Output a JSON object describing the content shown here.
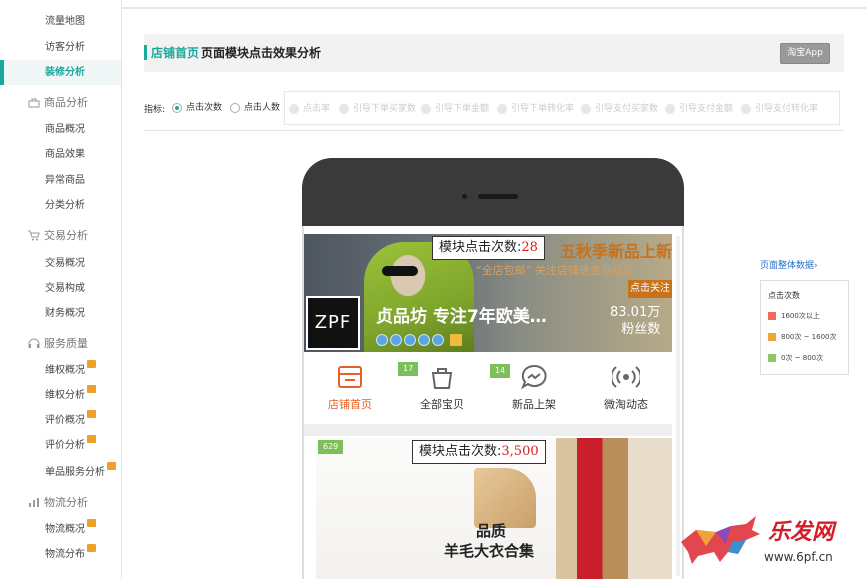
{
  "sidebar": {
    "items_top": [
      {
        "label": "流量地图"
      },
      {
        "label": "访客分析"
      },
      {
        "label": "装修分析",
        "active": true
      }
    ],
    "groups": [
      {
        "title": "商品分析",
        "icon": "bag-icon",
        "items": [
          "商品概况",
          "商品效果",
          "异常商品",
          "分类分析"
        ]
      },
      {
        "title": "交易分析",
        "icon": "cart-icon",
        "items": [
          "交易概况",
          "交易构成",
          "财务概况"
        ]
      },
      {
        "title": "服务质量",
        "icon": "headset-icon",
        "items": [
          "维权概况",
          "维权分析",
          "评价概况",
          "评价分析",
          "单品服务分析"
        ]
      },
      {
        "title": "物流分析",
        "icon": "bar-chart-icon",
        "items": [
          "物流概况",
          "物流分布"
        ]
      }
    ]
  },
  "header": {
    "crumb": "店铺首页",
    "title": "页面模块点击效果分析",
    "button": "淘宝App"
  },
  "metrics": {
    "label": "指标:",
    "radio1": "点击次数",
    "radio2": "点击人数",
    "options": [
      "点击率",
      "引导下单买家数",
      "引导下单金额",
      "引导下单转化率",
      "引导支付买家数",
      "引导支付金额",
      "引导支付转化率"
    ]
  },
  "shop": {
    "promo": "五秋季新品上新",
    "promo_sub": "“全店包邮” 关注店铺送会员福分",
    "follow": "点击关注",
    "logo": "ZPF",
    "name": "贞品坊 专注7年欧美…",
    "fans_num": "83.01万",
    "fans_label": "粉丝数"
  },
  "counters": {
    "label": "模块点击次数:",
    "banner_value": "28",
    "product_value": "3,500"
  },
  "nav": [
    {
      "label": "店铺首页",
      "icon": "shop-icon"
    },
    {
      "label": "全部宝贝",
      "icon": "bag-icon"
    },
    {
      "label": "新品上架",
      "icon": "message-icon"
    },
    {
      "label": "微淘动态",
      "icon": "broadcast-icon"
    }
  ],
  "tags": {
    "t1": "17",
    "t2": "14",
    "t3": "629"
  },
  "product": {
    "line1": "品质",
    "line2": "羊毛大衣合集"
  },
  "legend": {
    "link": "页面整体数据",
    "title": "点击次数",
    "rows": [
      {
        "label": "1600次以上",
        "color": "#f06a5a"
      },
      {
        "label": "800次 ~ 1600次",
        "color": "#f0a53a"
      },
      {
        "label": "0次 ~ 800次",
        "color": "#8cc76a"
      }
    ]
  },
  "watermark": {
    "text": "乐发网",
    "url": "www.6pf.cn"
  }
}
